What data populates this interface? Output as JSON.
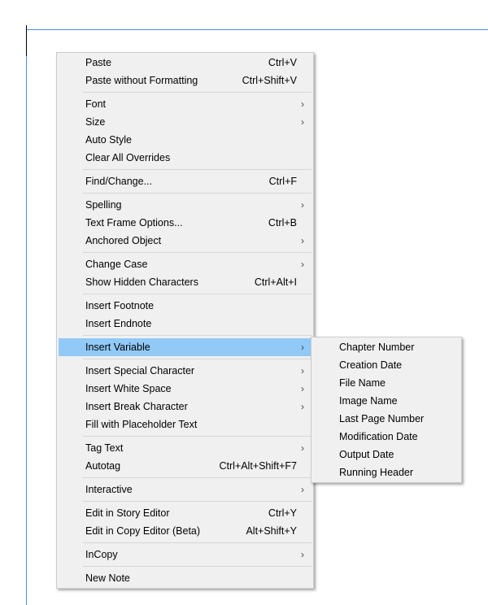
{
  "menu": [
    [
      {
        "label": "Paste",
        "shortcut": "Ctrl+V"
      },
      {
        "label": "Paste without Formatting",
        "shortcut": "Ctrl+Shift+V"
      }
    ],
    [
      {
        "label": "Font",
        "submenu": true
      },
      {
        "label": "Size",
        "submenu": true
      },
      {
        "label": "Auto Style"
      },
      {
        "label": "Clear All Overrides"
      }
    ],
    [
      {
        "label": "Find/Change...",
        "shortcut": "Ctrl+F"
      }
    ],
    [
      {
        "label": "Spelling",
        "submenu": true
      },
      {
        "label": "Text Frame Options...",
        "shortcut": "Ctrl+B"
      },
      {
        "label": "Anchored Object",
        "submenu": true
      }
    ],
    [
      {
        "label": "Change Case",
        "submenu": true
      },
      {
        "label": "Show Hidden Characters",
        "shortcut": "Ctrl+Alt+I"
      }
    ],
    [
      {
        "label": "Insert Footnote"
      },
      {
        "label": "Insert Endnote"
      }
    ],
    [
      {
        "label": "Insert Variable",
        "submenu": true,
        "highlighted": true
      }
    ],
    [
      {
        "label": "Insert Special Character",
        "submenu": true
      },
      {
        "label": "Insert White Space",
        "submenu": true
      },
      {
        "label": "Insert Break Character",
        "submenu": true
      },
      {
        "label": "Fill with Placeholder Text"
      }
    ],
    [
      {
        "label": "Tag Text",
        "submenu": true
      },
      {
        "label": "Autotag",
        "shortcut": "Ctrl+Alt+Shift+F7"
      }
    ],
    [
      {
        "label": "Interactive",
        "submenu": true
      }
    ],
    [
      {
        "label": "Edit in Story Editor",
        "shortcut": "Ctrl+Y"
      },
      {
        "label": "Edit in Copy Editor (Beta)",
        "shortcut": "Alt+Shift+Y"
      }
    ],
    [
      {
        "label": "InCopy",
        "submenu": true
      }
    ],
    [
      {
        "label": "New Note"
      }
    ]
  ],
  "submenu": [
    "Chapter Number",
    "Creation Date",
    "File Name",
    "Image Name",
    "Last Page Number",
    "Modification Date",
    "Output Date",
    "Running Header"
  ],
  "arrow": "›",
  "colors": {
    "highlight": "#91c9f7",
    "frame": "#4a90e2"
  }
}
